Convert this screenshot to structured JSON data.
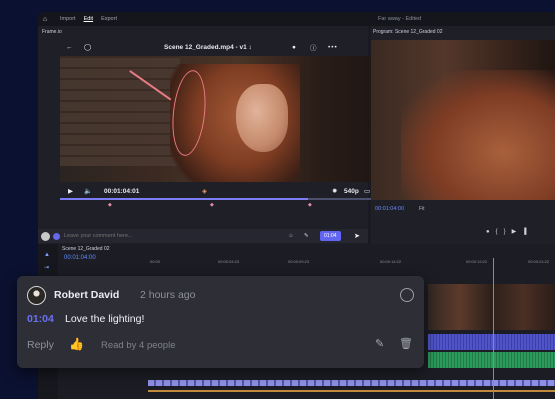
{
  "menubar": {
    "items": [
      "Import",
      "Edit",
      "Export"
    ],
    "active": "Edit",
    "document_title": "Far away - Edited"
  },
  "review_panel": {
    "tab": "Frame.io",
    "video_title": "Scene 12_Graded.mp4 - v1 ↕",
    "timecode": "00:01:04:01",
    "resolution": "540p",
    "progress": 0.77,
    "comment_placeholder": "Leave your comment here...",
    "comment_time_chip": "01:04"
  },
  "program_panel": {
    "tab": "Program: Scene 12_Graded 02",
    "timecode": "00:01:04:00",
    "fit": "Fit"
  },
  "timeline": {
    "tab": "Scene 12_Graded 02",
    "timecode": "00:01:04:00",
    "ruler": [
      "00:00",
      "00:00:04:23",
      "00:00:09:23",
      "00:00:14:22",
      "00:00:19:22",
      "00:00:24:22"
    ]
  },
  "comment": {
    "author": "Robert David",
    "time_ago": "2 hours ago",
    "timecode": "01:04",
    "text": "Love the lighting!",
    "reply_label": "Reply",
    "read_status": "Read by 4 people"
  },
  "icons": {
    "home": "home-icon",
    "like": "thumbs-up-icon",
    "edit": "pencil-icon",
    "delete": "trash-icon",
    "resolve": "circle-check-icon"
  },
  "colors": {
    "accent": "#6668F0",
    "annotation": "#E87A85",
    "timecode": "#5F8DFF"
  }
}
